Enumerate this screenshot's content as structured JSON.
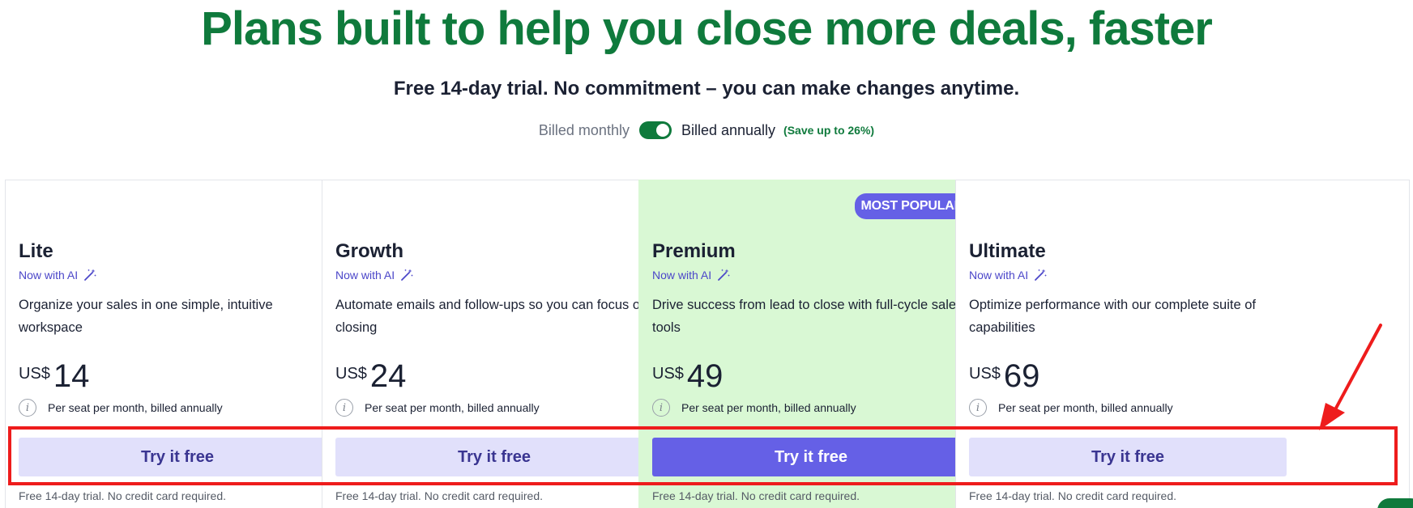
{
  "header": {
    "headline": "Plans built to help you close more deals, faster",
    "subhead": "Free 14-day trial. No commitment – you can make changes anytime."
  },
  "billing": {
    "monthly_label": "Billed monthly",
    "annual_label": "Billed annually",
    "save_label": "(Save up to 26%)",
    "annual_selected": true
  },
  "plans": [
    {
      "name": "Lite",
      "ai_label": "Now with AI",
      "description": "Organize your sales in one simple, intuitive workspace",
      "currency": "US$",
      "price": "14",
      "billing_note": "Per seat per month, billed annually",
      "cta": "Try it free",
      "trial_note": "Free 14-day trial. No credit card required."
    },
    {
      "name": "Growth",
      "ai_label": "Now with AI",
      "description": "Automate emails and follow-ups so you can focus on closing",
      "currency": "US$",
      "price": "24",
      "billing_note": "Per seat per month, billed annually",
      "cta": "Try it free",
      "trial_note": "Free 14-day trial. No credit card required."
    },
    {
      "name": "Premium",
      "badge": "MOST POPULAR",
      "ai_label": "Now with AI",
      "description": "Drive success from lead to close with full-cycle sales tools",
      "currency": "US$",
      "price": "49",
      "billing_note": "Per seat per month, billed annually",
      "cta": "Try it free",
      "trial_note": "Free 14-day trial. No credit card required."
    },
    {
      "name": "Ultimate",
      "ai_label": "Now with AI",
      "description": "Optimize performance with our complete suite of capabilities",
      "currency": "US$",
      "price": "69",
      "billing_note": "Per seat per month, billed annually",
      "cta": "Try it free",
      "trial_note": "Free 14-day trial. No credit card required."
    }
  ],
  "icons": {
    "ai": "magic-wand-icon",
    "info": "info-icon"
  },
  "colors": {
    "brand_green": "#0f7a3c",
    "accent_purple": "#6560e6",
    "popular_bg": "#d9f8d4",
    "annotation_red": "#ee1c1c"
  }
}
